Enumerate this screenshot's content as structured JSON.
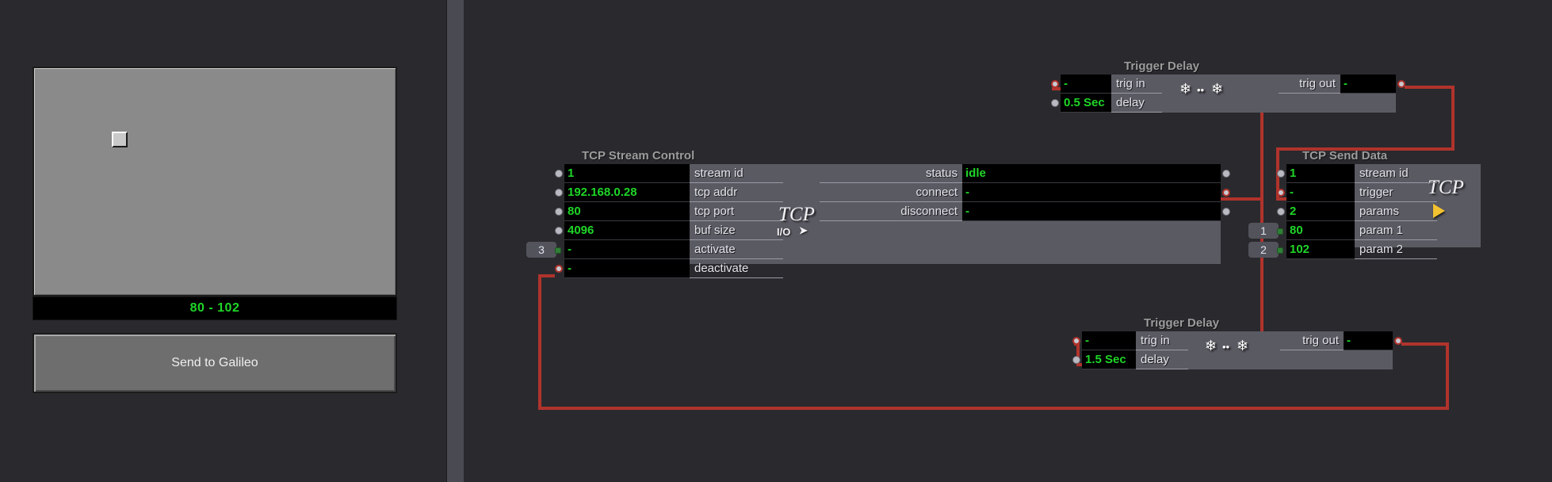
{
  "app": {
    "accent_green": "#1fd628",
    "wire_color": "#b0332c",
    "node_body_color": "#5a5a63",
    "canvas_color": "#2a2a2e"
  },
  "left_panel": {
    "toggle": {
      "name": "toggle-checkbox",
      "checked": false
    },
    "readout": {
      "value": "80 - 102"
    },
    "send_button": {
      "label": "Send to Galileo"
    }
  },
  "nodes": {
    "tcp_stream_control": {
      "title": "TCP Stream Control",
      "watermark": "TCP",
      "watermark_sub": "I/O",
      "inputs": [
        {
          "label": "stream id",
          "value": "1",
          "badge": ""
        },
        {
          "label": "tcp addr",
          "value": "192.168.0.28",
          "badge": ""
        },
        {
          "label": "tcp port",
          "value": "80",
          "badge": ""
        },
        {
          "label": "buf size",
          "value": "4096",
          "badge": ""
        },
        {
          "label": "activate",
          "value": "-",
          "badge": "3"
        },
        {
          "label": "deactivate",
          "value": "-",
          "badge": ""
        }
      ],
      "outputs": [
        {
          "label": "status",
          "value": "idle"
        },
        {
          "label": "connect",
          "value": "-"
        },
        {
          "label": "disconnect",
          "value": "-"
        }
      ]
    },
    "tcp_send_data": {
      "title": "TCP Send Data",
      "watermark": "TCP",
      "inputs": [
        {
          "label": "stream id",
          "value": "1",
          "badge": ""
        },
        {
          "label": "trigger",
          "value": "-",
          "badge": ""
        },
        {
          "label": "params",
          "value": "2",
          "badge": ""
        },
        {
          "label": "param 1",
          "value": "80",
          "badge": "1"
        },
        {
          "label": "param 2",
          "value": "102",
          "badge": "2"
        }
      ]
    },
    "trigger_delay_top": {
      "title": "Trigger Delay",
      "trig_in_label": "trig in",
      "trig_in_value": "-",
      "delay_label": "delay",
      "delay_value": "0.5 Sec",
      "trig_out_label": "trig out",
      "trig_out_value": "-"
    },
    "trigger_delay_bottom": {
      "title": "Trigger Delay",
      "trig_in_label": "trig in",
      "trig_in_value": "-",
      "delay_label": "delay",
      "delay_value": "1.5 Sec",
      "trig_out_label": "trig out",
      "trig_out_value": "-"
    }
  }
}
